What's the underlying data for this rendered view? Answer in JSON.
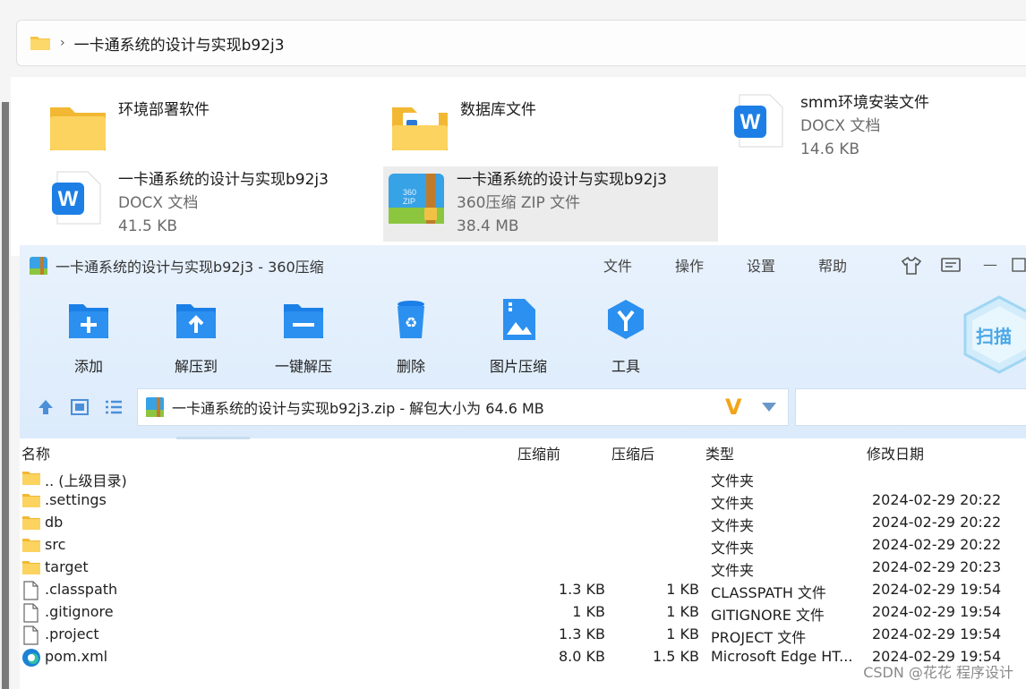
{
  "explorer": {
    "breadcrumb": "一卡通系统的设计与实现b92j3",
    "items": [
      {
        "name": "环境部署软件",
        "type": "",
        "size": ""
      },
      {
        "name": "数据库文件",
        "type": "",
        "size": ""
      },
      {
        "name": "smm环境安装文件",
        "type": "DOCX 文档",
        "size": "14.6 KB"
      },
      {
        "name": "一卡通系统的设计与实现b92j3",
        "type": "DOCX 文档",
        "size": "41.5 KB"
      },
      {
        "name": "一卡通系统的设计与实现b92j3",
        "type": "360压缩 ZIP 文件",
        "size": "38.4 MB"
      }
    ]
  },
  "archiver": {
    "title": "一卡通系统的设计与实现b92j3 - 360压缩",
    "menu": [
      "文件",
      "操作",
      "设置",
      "帮助"
    ],
    "toolbar": [
      "添加",
      "解压到",
      "一键解压",
      "删除",
      "图片压缩",
      "工具"
    ],
    "scan_label": "扫描",
    "path_text": "一卡通系统的设计与实现b92j3.zip - 解包大小为 64.6 MB",
    "columns": [
      "名称",
      "压缩前",
      "压缩后",
      "类型",
      "修改日期"
    ],
    "rows": [
      {
        "name": ".. (上级目录)",
        "before": "",
        "after": "",
        "type": "文件夹",
        "date": "",
        "icon": "folder"
      },
      {
        "name": ".settings",
        "before": "",
        "after": "",
        "type": "文件夹",
        "date": "2024-02-29 20:22",
        "icon": "folder"
      },
      {
        "name": "db",
        "before": "",
        "after": "",
        "type": "文件夹",
        "date": "2024-02-29 20:22",
        "icon": "folder"
      },
      {
        "name": "src",
        "before": "",
        "after": "",
        "type": "文件夹",
        "date": "2024-02-29 20:22",
        "icon": "folder"
      },
      {
        "name": "target",
        "before": "",
        "after": "",
        "type": "文件夹",
        "date": "2024-02-29 20:23",
        "icon": "folder"
      },
      {
        "name": ".classpath",
        "before": "1.3 KB",
        "after": "1 KB",
        "type": "CLASSPATH 文件",
        "date": "2024-02-29 19:54",
        "icon": "file"
      },
      {
        "name": ".gitignore",
        "before": "1 KB",
        "after": "1 KB",
        "type": "GITIGNORE 文件",
        "date": "2024-02-29 19:54",
        "icon": "file"
      },
      {
        "name": ".project",
        "before": "1.3 KB",
        "after": "1 KB",
        "type": "PROJECT 文件",
        "date": "2024-02-29 19:54",
        "icon": "file"
      },
      {
        "name": "pom.xml",
        "before": "8.0 KB",
        "after": "1.5 KB",
        "type": "Microsoft Edge HT...",
        "date": "2024-02-29 19:54",
        "icon": "edge"
      }
    ]
  },
  "watermark": "CSDN @花花 程序设计",
  "colors": {
    "accent": "#1a8cff",
    "folder": "#f4c44f",
    "window_bg": "#e3effc"
  }
}
